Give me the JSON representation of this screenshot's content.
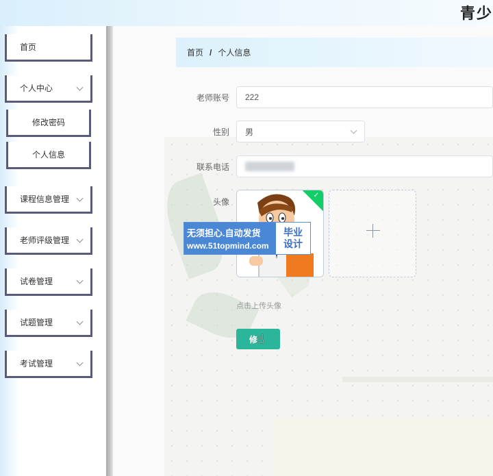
{
  "header": {
    "title": "青少"
  },
  "sidebar": {
    "items": [
      {
        "label": "首页",
        "has_arrow": false
      },
      {
        "label": "个人中心",
        "has_arrow": true
      },
      {
        "label": "修改密码",
        "has_arrow": false,
        "sub": true
      },
      {
        "label": "个人信息",
        "has_arrow": false,
        "sub": true
      },
      {
        "label": "课程信息管理",
        "has_arrow": true
      },
      {
        "label": "老师评级管理",
        "has_arrow": true
      },
      {
        "label": "试卷管理",
        "has_arrow": true
      },
      {
        "label": "试题管理",
        "has_arrow": true
      },
      {
        "label": "考试管理",
        "has_arrow": true
      }
    ]
  },
  "breadcrumb": {
    "home": "首页",
    "separator": "/",
    "current": "个人信息"
  },
  "form": {
    "account_label": "老师账号",
    "account_value": "222",
    "gender_label": "性别",
    "gender_value": "男",
    "phone_label": "联系电话",
    "avatar_label": "头像",
    "upload_hint": "点击上传头像",
    "submit_label": "修"
  },
  "watermark": {
    "line1": "无须担心.自动发货",
    "line2": "www.51topmind.com",
    "badge1": "毕业",
    "badge2": "设计"
  },
  "icons": {
    "plus": "plus-icon",
    "check": "check-icon",
    "cursor": "hand-cursor-icon",
    "chevron": "chevron-down-icon"
  },
  "colors": {
    "accent": "#2bb59a",
    "sidebar_border": "#5a5a7a",
    "breadcrumb_bg": "#dcf1fc",
    "success": "#13ce66"
  }
}
